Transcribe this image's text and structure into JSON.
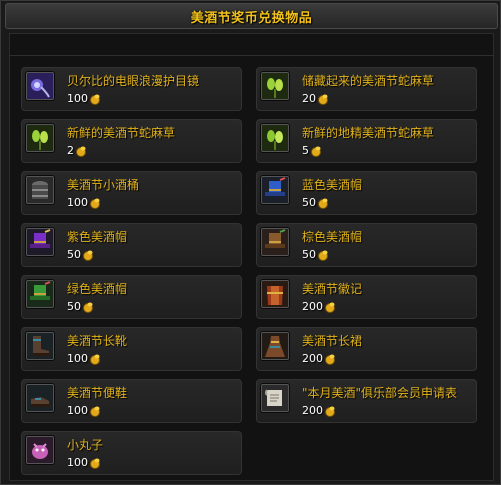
{
  "window": {
    "title": "美酒节奖币兑换物品"
  },
  "currency": {
    "icon": "brewfest-token-icon",
    "color": "#f2c21a"
  },
  "items": [
    {
      "name": "贝尔比的电眼浪漫护目镜",
      "price": "100",
      "icon": "goggles-icon"
    },
    {
      "name": "储藏起来的美酒节蛇麻草",
      "price": "20",
      "icon": "hops-icon"
    },
    {
      "name": "新鲜的美酒节蛇麻草",
      "price": "2",
      "icon": "hops-icon"
    },
    {
      "name": "新鲜的地精美酒节蛇麻草",
      "price": "5",
      "icon": "hops-icon"
    },
    {
      "name": "美酒节小酒桶",
      "price": "100",
      "icon": "keg-icon"
    },
    {
      "name": "蓝色美酒帽",
      "price": "50",
      "icon": "blue-hat-icon"
    },
    {
      "name": "紫色美酒帽",
      "price": "50",
      "icon": "purple-hat-icon"
    },
    {
      "name": "棕色美酒帽",
      "price": "50",
      "icon": "brown-hat-icon"
    },
    {
      "name": "绿色美酒帽",
      "price": "50",
      "icon": "green-hat-icon"
    },
    {
      "name": "美酒节徽记",
      "price": "200",
      "icon": "tabard-icon"
    },
    {
      "name": "美酒节长靴",
      "price": "100",
      "icon": "boots-icon"
    },
    {
      "name": "美酒节长裙",
      "price": "200",
      "icon": "dress-icon"
    },
    {
      "name": "美酒节便鞋",
      "price": "100",
      "icon": "shoes-icon"
    },
    {
      "name": "\"本月美酒\"俱乐部会员申请表",
      "price": "200",
      "icon": "scroll-icon"
    },
    {
      "name": "小丸子",
      "price": "100",
      "icon": "pet-icon"
    }
  ]
}
